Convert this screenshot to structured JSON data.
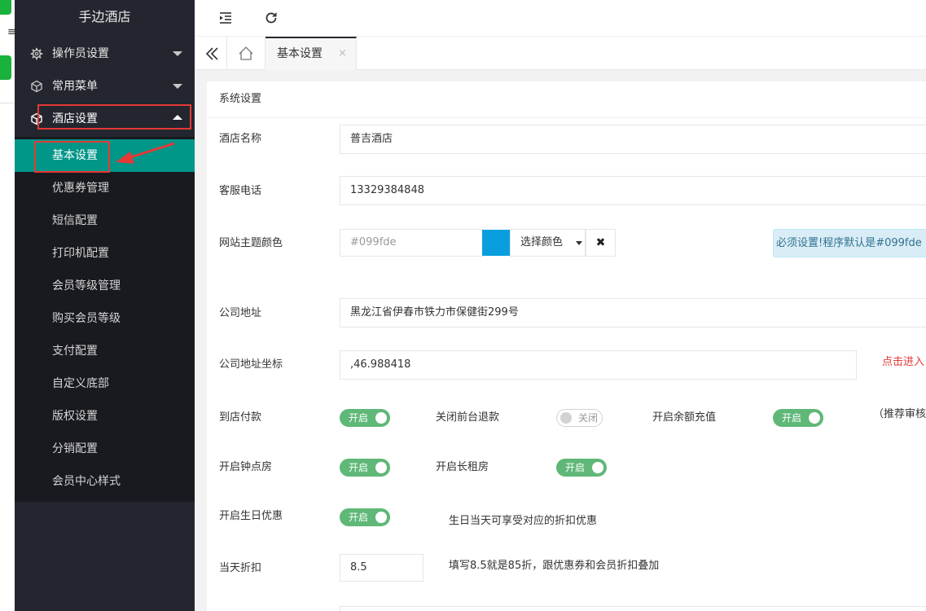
{
  "sidebar": {
    "title": "手边酒店",
    "groups": [
      {
        "label": "操作员设置",
        "icon": "gear-icon"
      },
      {
        "label": "常用菜单",
        "icon": "cube-icon"
      },
      {
        "label": "酒店设置",
        "icon": "cube-icon"
      }
    ],
    "submenu": [
      "基本设置",
      "优惠券管理",
      "短信配置",
      "打印机配置",
      "会员等级管理",
      "购买会员等级",
      "支付配置",
      "自定义底部",
      "版权设置",
      "分销配置",
      "会员中心样式"
    ]
  },
  "header": {
    "icons": [
      "indent-icon",
      "refresh-icon"
    ]
  },
  "tabs": {
    "active_label": "基本设置",
    "close_glyph": "×"
  },
  "form": {
    "section_title": "系统设置",
    "hotel_name": {
      "label": "酒店名称",
      "value": "普吉酒店"
    },
    "service_phone": {
      "label": "客服电话",
      "value": "13329384848"
    },
    "theme_color": {
      "label": "网站主题颜色",
      "placeholder": "#099fde",
      "swatch_color": "#099fde",
      "pick_label": "选择颜色",
      "clear_glyph": "✖",
      "notice": "必须设置!程序默认是#099fde"
    },
    "address": {
      "label": "公司地址",
      "value": "黑龙江省伊春市铁力市保健街299号"
    },
    "coords": {
      "label": "公司地址坐标",
      "value": ",46.988418",
      "link": "点击进入"
    },
    "switches": {
      "pay_at_store": {
        "label": "到店付款",
        "state": "开启"
      },
      "close_refund": {
        "label": "关闭前台退款",
        "state": "关闭"
      },
      "balance_recharge": {
        "label": "开启余额充值",
        "state": "开启"
      },
      "recommend_note": "（推荐审核",
      "hourly_room": {
        "label": "开启钟点房",
        "state": "开启"
      },
      "long_rent": {
        "label": "开启长租房",
        "state": "开启"
      },
      "birthday": {
        "label": "开启生日优惠",
        "state": "开启",
        "hint": "生日当天可享受对应的折扣优惠"
      }
    },
    "discount": {
      "label": "当天折扣",
      "value": "8.5",
      "hint": "填写8.5就是85折，跟优惠券和会员折扣叠加"
    }
  }
}
